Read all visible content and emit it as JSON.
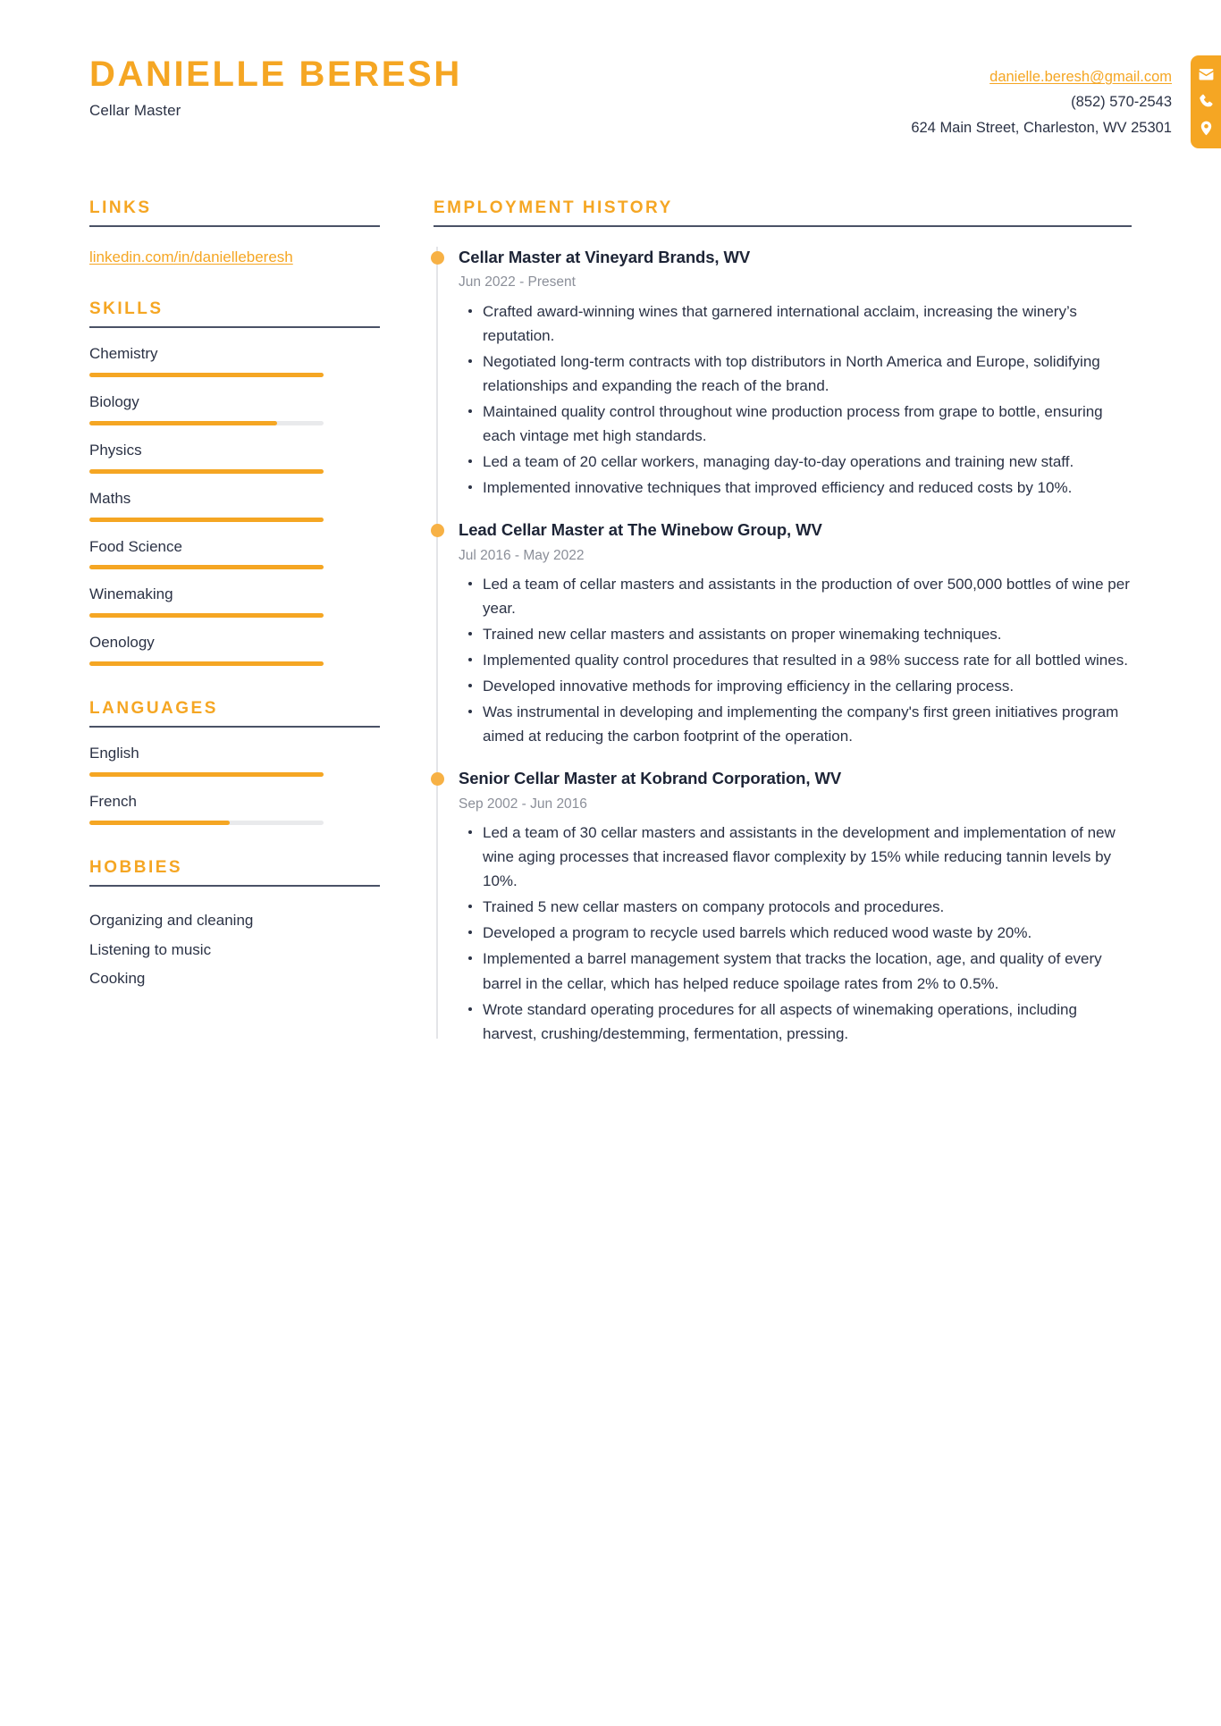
{
  "header": {
    "full_name": "DANIELLE BERESH",
    "job_title": "Cellar Master",
    "contact": {
      "email": "danielle.beresh@gmail.com",
      "phone": "(852) 570-2543",
      "address": "624 Main Street, Charleston, WV 25301"
    },
    "icons": [
      "envelope-icon",
      "phone-icon",
      "location-pin-icon"
    ]
  },
  "theme": {
    "accent": "#F5A623",
    "text": "#2B3245",
    "muted": "#8B8F99",
    "rule": "#4A5266",
    "track": "#E9EAEC"
  },
  "sidebar": {
    "links": {
      "title": "LINKS",
      "items": [
        {
          "label": "linkedin.com/in/danielleberesh"
        }
      ]
    },
    "skills": {
      "title": "SKILLS",
      "items": [
        {
          "label": "Chemistry",
          "level": 100
        },
        {
          "label": "Biology",
          "level": 80
        },
        {
          "label": "Physics",
          "level": 100
        },
        {
          "label": "Maths",
          "level": 100
        },
        {
          "label": "Food Science",
          "level": 100
        },
        {
          "label": "Winemaking",
          "level": 100
        },
        {
          "label": "Oenology",
          "level": 100
        }
      ]
    },
    "languages": {
      "title": "LANGUAGES",
      "items": [
        {
          "label": "English",
          "level": 100
        },
        {
          "label": "French",
          "level": 60
        }
      ]
    },
    "hobbies": {
      "title": "HOBBIES",
      "items": [
        {
          "label": "Organizing and cleaning"
        },
        {
          "label": "Listening to music"
        },
        {
          "label": "Cooking"
        }
      ]
    }
  },
  "main": {
    "employment": {
      "title": "EMPLOYMENT HISTORY",
      "jobs": [
        {
          "heading": "Cellar Master at Vineyard Brands, WV",
          "dates": "Jun 2022 - Present",
          "bullets": [
            {
              "text": "Crafted award-winning wines that garnered international acclaim, increasing the winery’s reputation."
            },
            {
              "text": "Negotiated long-term contracts with top distributors in North America and Europe, solidifying relationships and expanding the reach of the brand."
            },
            {
              "text": "Maintained quality control throughout wine production process from grape to bottle, ensuring each vintage met high standards."
            },
            {
              "text": "Led a team of 20 cellar workers, managing day-to-day operations and training new staff."
            },
            {
              "text": "Implemented innovative techniques that improved efficiency and reduced costs by 10%."
            }
          ]
        },
        {
          "heading": "Lead Cellar Master at The Winebow Group, WV",
          "dates": "Jul 2016 - May 2022",
          "bullets": [
            {
              "text": "Led a team of cellar masters and assistants in the production of over 500,000 bottles of wine per year."
            },
            {
              "text": "Trained new cellar masters and assistants on proper winemaking techniques."
            },
            {
              "text": "Implemented quality control procedures that resulted in a 98% success rate for all bottled wines."
            },
            {
              "text": "Developed innovative methods for improving efficiency in the cellaring process."
            },
            {
              "text": "Was instrumental in developing and implementing the company's first green initiatives program aimed at reducing the carbon footprint of the operation."
            }
          ]
        },
        {
          "heading": "Senior Cellar Master at Kobrand Corporation, WV",
          "dates": "Sep 2002 - Jun 2016",
          "bullets": [
            {
              "text": "Led a team of 30 cellar masters and assistants in the development and implementation of new wine aging processes that increased flavor complexity by 15% while reducing tannin levels by 10%."
            },
            {
              "text": "Trained 5 new cellar masters on company protocols and procedures."
            },
            {
              "text": "Developed a program to recycle used barrels which reduced wood waste by 20%."
            },
            {
              "text": "Implemented a barrel management system that tracks the location, age, and quality of every barrel in the cellar, which has helped reduce spoilage rates from 2% to 0.5%."
            },
            {
              "text": "Wrote standard operating procedures for all aspects of winemaking operations, including harvest, crushing/destemming, fermentation, pressing."
            }
          ]
        }
      ]
    }
  }
}
